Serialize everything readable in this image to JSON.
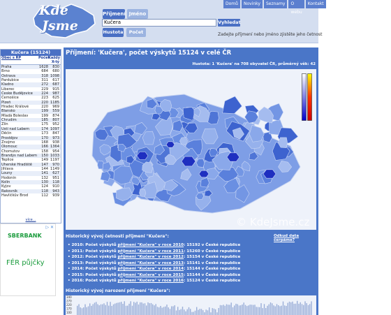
{
  "header": {
    "logo_line1": "Kde",
    "logo_line2": "Jsme",
    "tabs": [
      {
        "label": "Příjmení"
      },
      {
        "label": "Jméno"
      }
    ],
    "search_value": "Kučera",
    "search_button": "Vyhledat",
    "mode_buttons": [
      {
        "label": "Hustota"
      },
      {
        "label": "Počet"
      }
    ],
    "hint": "Zadejte příjmení nebo jméno zjistěte jeho četnost"
  },
  "topnav": [
    "Domů",
    "Novinky",
    "Seznamy",
    "O webu",
    "Kontakt"
  ],
  "sidebar": {
    "title": "Kučera (15124)",
    "col_city": "Obec s RP",
    "col_count": "Počet",
    "col_per": "Každý X-tý",
    "rows": [
      [
        "Praha",
        "1628",
        "830"
      ],
      [
        "Brno",
        "684",
        "680"
      ],
      [
        "Ostrava",
        "318",
        "1098"
      ],
      [
        "Pardubice",
        "311",
        "617"
      ],
      [
        "Kladno",
        "272",
        "687"
      ],
      [
        "Liberec",
        "229",
        "915"
      ],
      [
        "České Budějovice",
        "224",
        "987"
      ],
      [
        "Čemošice",
        "223",
        "625"
      ],
      [
        "Plzeň",
        "220",
        "1185"
      ],
      [
        "Hradec Králové",
        "220",
        "969"
      ],
      [
        "Blansko",
        "199",
        "559"
      ],
      [
        "Mladá Boleslav",
        "199",
        "874"
      ],
      [
        "Chrudim",
        "185",
        "807"
      ],
      [
        "Zlín",
        "175",
        "952"
      ],
      [
        "Ústí nad Labem",
        "174",
        "1097"
      ],
      [
        "Děčín",
        "173",
        "847"
      ],
      [
        "Prostějov",
        "170",
        "973"
      ],
      [
        "Znojmo",
        "168",
        "938"
      ],
      [
        "Olomouc",
        "166",
        "1364"
      ],
      [
        "Chomutov",
        "158",
        "954"
      ],
      [
        "Brandýs nad Labem",
        "150",
        "1033"
      ],
      [
        "Teplice",
        "149",
        "1197"
      ],
      [
        "Uherské Hradiště",
        "147",
        "970"
      ],
      [
        "Jihlava",
        "144",
        "1149"
      ],
      [
        "Louny",
        "141",
        "627"
      ],
      [
        "Hodonín",
        "132",
        "951"
      ],
      [
        "Kolín",
        "130",
        "118"
      ],
      [
        "Kyjov",
        "124",
        "910"
      ],
      [
        "Rakovník",
        "118",
        "943"
      ],
      [
        "Havlíčkův Brod",
        "112",
        "939"
      ]
    ],
    "more": "více..."
  },
  "ad": {
    "brand": "SBERBANK",
    "headline": "FÉR půjčky",
    "close": "▷ ✕"
  },
  "main": {
    "title": "Příjmení: 'Kučera', počet výskytů 15124 v celé ČR",
    "subtitle": "Hustota: 1 'Kučera' na 708 obyvatel ČR, průměrný věk: 42",
    "watermark": "© KdeJsme.cz",
    "source_link": "Odkud data čerpáme?",
    "hist_title": "Historický vývoj četnosti příjmení \"Kučera\":",
    "hist": [
      {
        "year": "2010",
        "count": "15192"
      },
      {
        "year": "2011",
        "count": "15260"
      },
      {
        "year": "2012",
        "count": "15154"
      },
      {
        "year": "2013",
        "count": "15141"
      },
      {
        "year": "2014",
        "count": "15144"
      },
      {
        "year": "2015",
        "count": "15144"
      },
      {
        "year": "2016",
        "count": "15124"
      }
    ],
    "hist_prefix": "Počet výskytů",
    "hist_link_prefix": "příjmení \"Kučera\" v roce",
    "hist_suffix": "v České republice",
    "birth_title": "Historický vývoj narození příjmení \"Kučera\":",
    "birth_ticks": [
      "340",
      "270",
      "220",
      "170",
      "100"
    ]
  },
  "colors": {
    "accent": "#4a76c8",
    "header_bg": "#d4def0"
  }
}
